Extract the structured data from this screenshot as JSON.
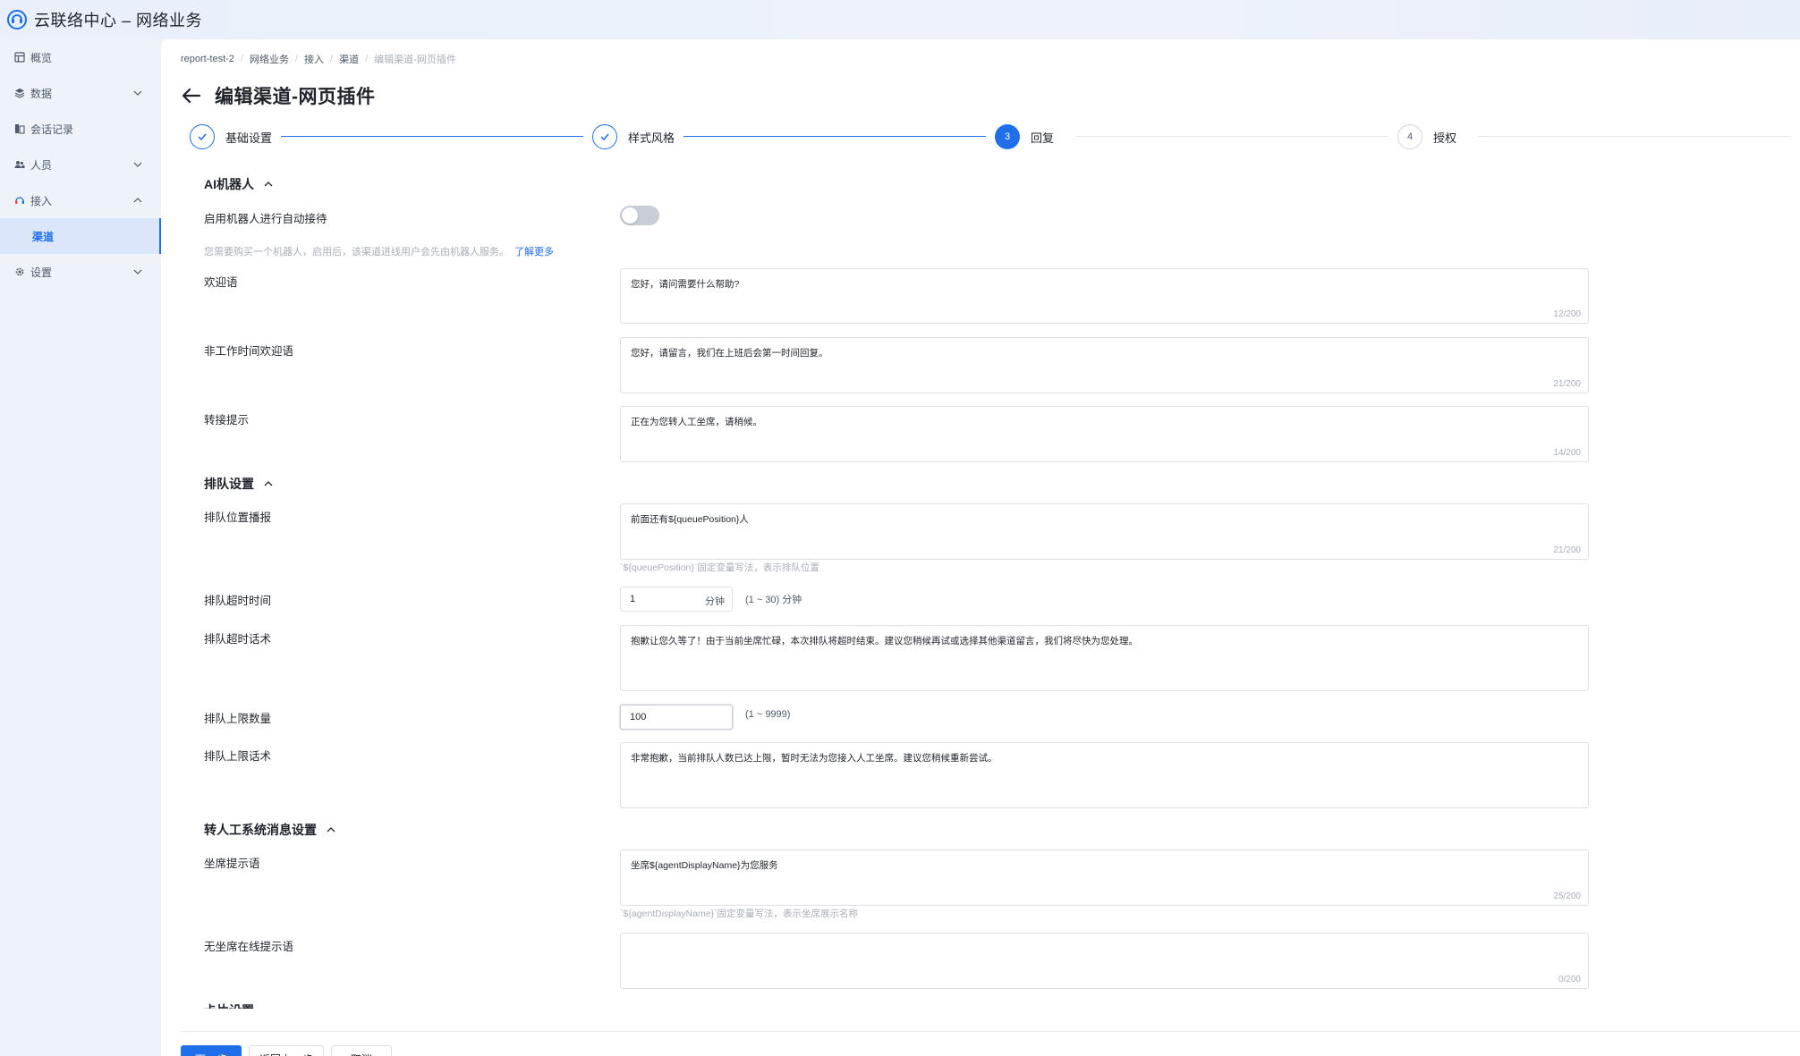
{
  "app": {
    "title": "云联络中心 – 网络业务"
  },
  "sidebar": {
    "items": [
      {
        "label": "概览",
        "icon": "dashboard-icon"
      },
      {
        "label": "数据",
        "icon": "layers-icon"
      },
      {
        "label": "会话记录",
        "icon": "chat-record-icon"
      },
      {
        "label": "人员",
        "icon": "users-icon"
      },
      {
        "label": "接入",
        "icon": "headset-icon"
      },
      {
        "label": "渠道"
      },
      {
        "label": "设置",
        "icon": "gear-icon"
      }
    ]
  },
  "breadcrumb": [
    "report-test-2",
    "网络业务",
    "接入",
    "渠道",
    "编辑渠道-网页插件"
  ],
  "page": {
    "title": "编辑渠道-网页插件"
  },
  "steps": [
    {
      "num": "1",
      "label": "基础设置",
      "state": "done"
    },
    {
      "num": "2",
      "label": "样式风格",
      "state": "done"
    },
    {
      "num": "3",
      "label": "回复",
      "state": "current"
    },
    {
      "num": "4",
      "label": "授权",
      "state": "todo"
    }
  ],
  "ai": {
    "section_title": "AI机器人",
    "enable_label": "启用机器人进行自动接待",
    "enabled": false,
    "hint": "您需要购买一个机器人，启用后，该渠道进线用户会先由机器人服务。",
    "learn_more": "了解更多",
    "welcome_label": "欢迎语",
    "welcome_value": "您好，请问需要什么帮助?",
    "welcome_count": "12/200",
    "offhours_label": "非工作时间欢迎语",
    "offhours_value": "您好，请留言，我们在上班后会第一时间回复。",
    "offhours_count": "21/200",
    "transfer_label": "转接提示",
    "transfer_value": "正在为您转人工坐席，请稍候。",
    "transfer_count": "14/200"
  },
  "queue": {
    "section_title": "排队设置",
    "position_label": "排队位置播报",
    "position_value": "前面还有${queuePosition}人",
    "position_count": "21/200",
    "position_hint": "`${queuePosition}`固定变量写法，表示排队位置",
    "timeout_label": "排队超时时间",
    "timeout_value": "1",
    "timeout_unit": "分钟",
    "timeout_range": "(1 ~ 30) 分钟",
    "timeout_msg_label": "排队超时话术",
    "timeout_msg_value": "抱歉让您久等了！由于当前坐席忙碌，本次排队将超时结束。建议您稍候再试或选择其他渠道留言，我们将尽快为您处理。",
    "limit_label": "排队上限数量",
    "limit_value": "100",
    "limit_range": "(1 ~ 9999)",
    "limit_msg_label": "排队上限话术",
    "limit_msg_value": "非常抱歉，当前排队人数已达上限，暂时无法为您接入人工坐席。建议您稍候重新尝试。"
  },
  "transfer_sys": {
    "section_title": "转人工系统消息设置",
    "agent_label": "坐席提示语",
    "agent_value": "坐席${agentDisplayName}为您服务",
    "agent_count": "25/200",
    "agent_hint": "`${agentDisplayName}`固定变量写法，表示坐席展示名称",
    "no_agent_label": "无坐席在线提示语",
    "no_agent_value": "",
    "no_agent_count": "0/200"
  },
  "partial_section": "卡片设置",
  "footer": {
    "next": "下一步",
    "prev": "返回上一步",
    "cancel": "取消"
  },
  "colors": {
    "primary": "#1f6feb",
    "sidebar_bg": "#eef2f9"
  }
}
